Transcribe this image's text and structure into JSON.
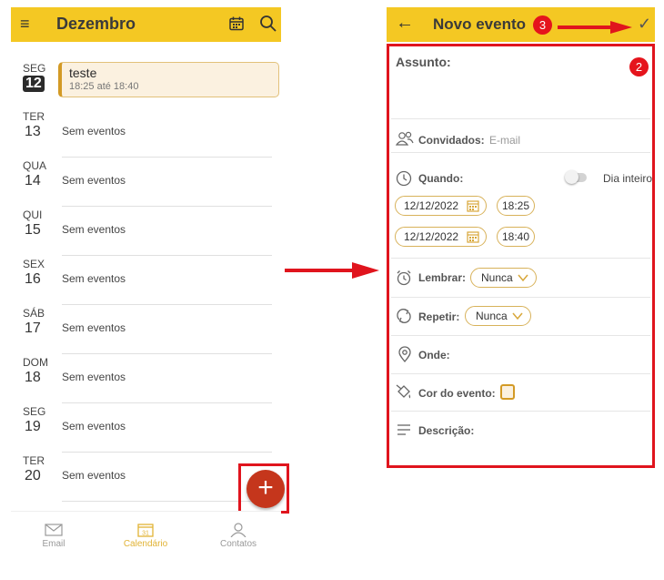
{
  "left_screen": {
    "header": {
      "title": "Dezembro"
    },
    "event": {
      "title": "teste",
      "time": "18:25 até 18:40"
    },
    "days": [
      {
        "dow": "SEG",
        "num": "12",
        "text": ""
      },
      {
        "dow": "TER",
        "num": "13",
        "text": "Sem eventos"
      },
      {
        "dow": "QUA",
        "num": "14",
        "text": "Sem eventos"
      },
      {
        "dow": "QUI",
        "num": "15",
        "text": "Sem eventos"
      },
      {
        "dow": "SEX",
        "num": "16",
        "text": "Sem eventos"
      },
      {
        "dow": "SÁB",
        "num": "17",
        "text": "Sem eventos"
      },
      {
        "dow": "DOM",
        "num": "18",
        "text": "Sem eventos"
      },
      {
        "dow": "SEG",
        "num": "19",
        "text": "Sem eventos"
      },
      {
        "dow": "TER",
        "num": "20",
        "text": "Sem eventos"
      }
    ],
    "fab": {
      "label": "+"
    },
    "bottom_nav": [
      {
        "label": "Email",
        "icon": "mail-icon",
        "active": false
      },
      {
        "label": "Calendário",
        "icon": "calendar-icon",
        "active": true
      },
      {
        "label": "Contatos",
        "icon": "contacts-icon",
        "active": false
      }
    ]
  },
  "right_screen": {
    "header": {
      "title": "Novo evento",
      "confirm": "✓",
      "back": "←"
    },
    "badges": {
      "form": "2",
      "confirm": "3"
    },
    "form": {
      "subject_label": "Assunto:",
      "guests_label": "Convidados:",
      "guests_placeholder": "E-mail",
      "when_label": "Quando:",
      "all_day_label": "Dia inteiro",
      "start_date": "12/12/2022",
      "start_time": "18:25",
      "end_date": "12/12/2022",
      "end_time": "18:40",
      "remind_label": "Lembrar:",
      "remind_value": "Nunca",
      "repeat_label": "Repetir:",
      "repeat_value": "Nunca",
      "where_label": "Onde:",
      "color_label": "Cor do evento:",
      "description_label": "Descrição:"
    }
  },
  "colors": {
    "header_yellow": "#f4c823",
    "fab_red": "#c5361c",
    "annotation_red": "#e0141d",
    "accent_gold": "#d39a25"
  }
}
